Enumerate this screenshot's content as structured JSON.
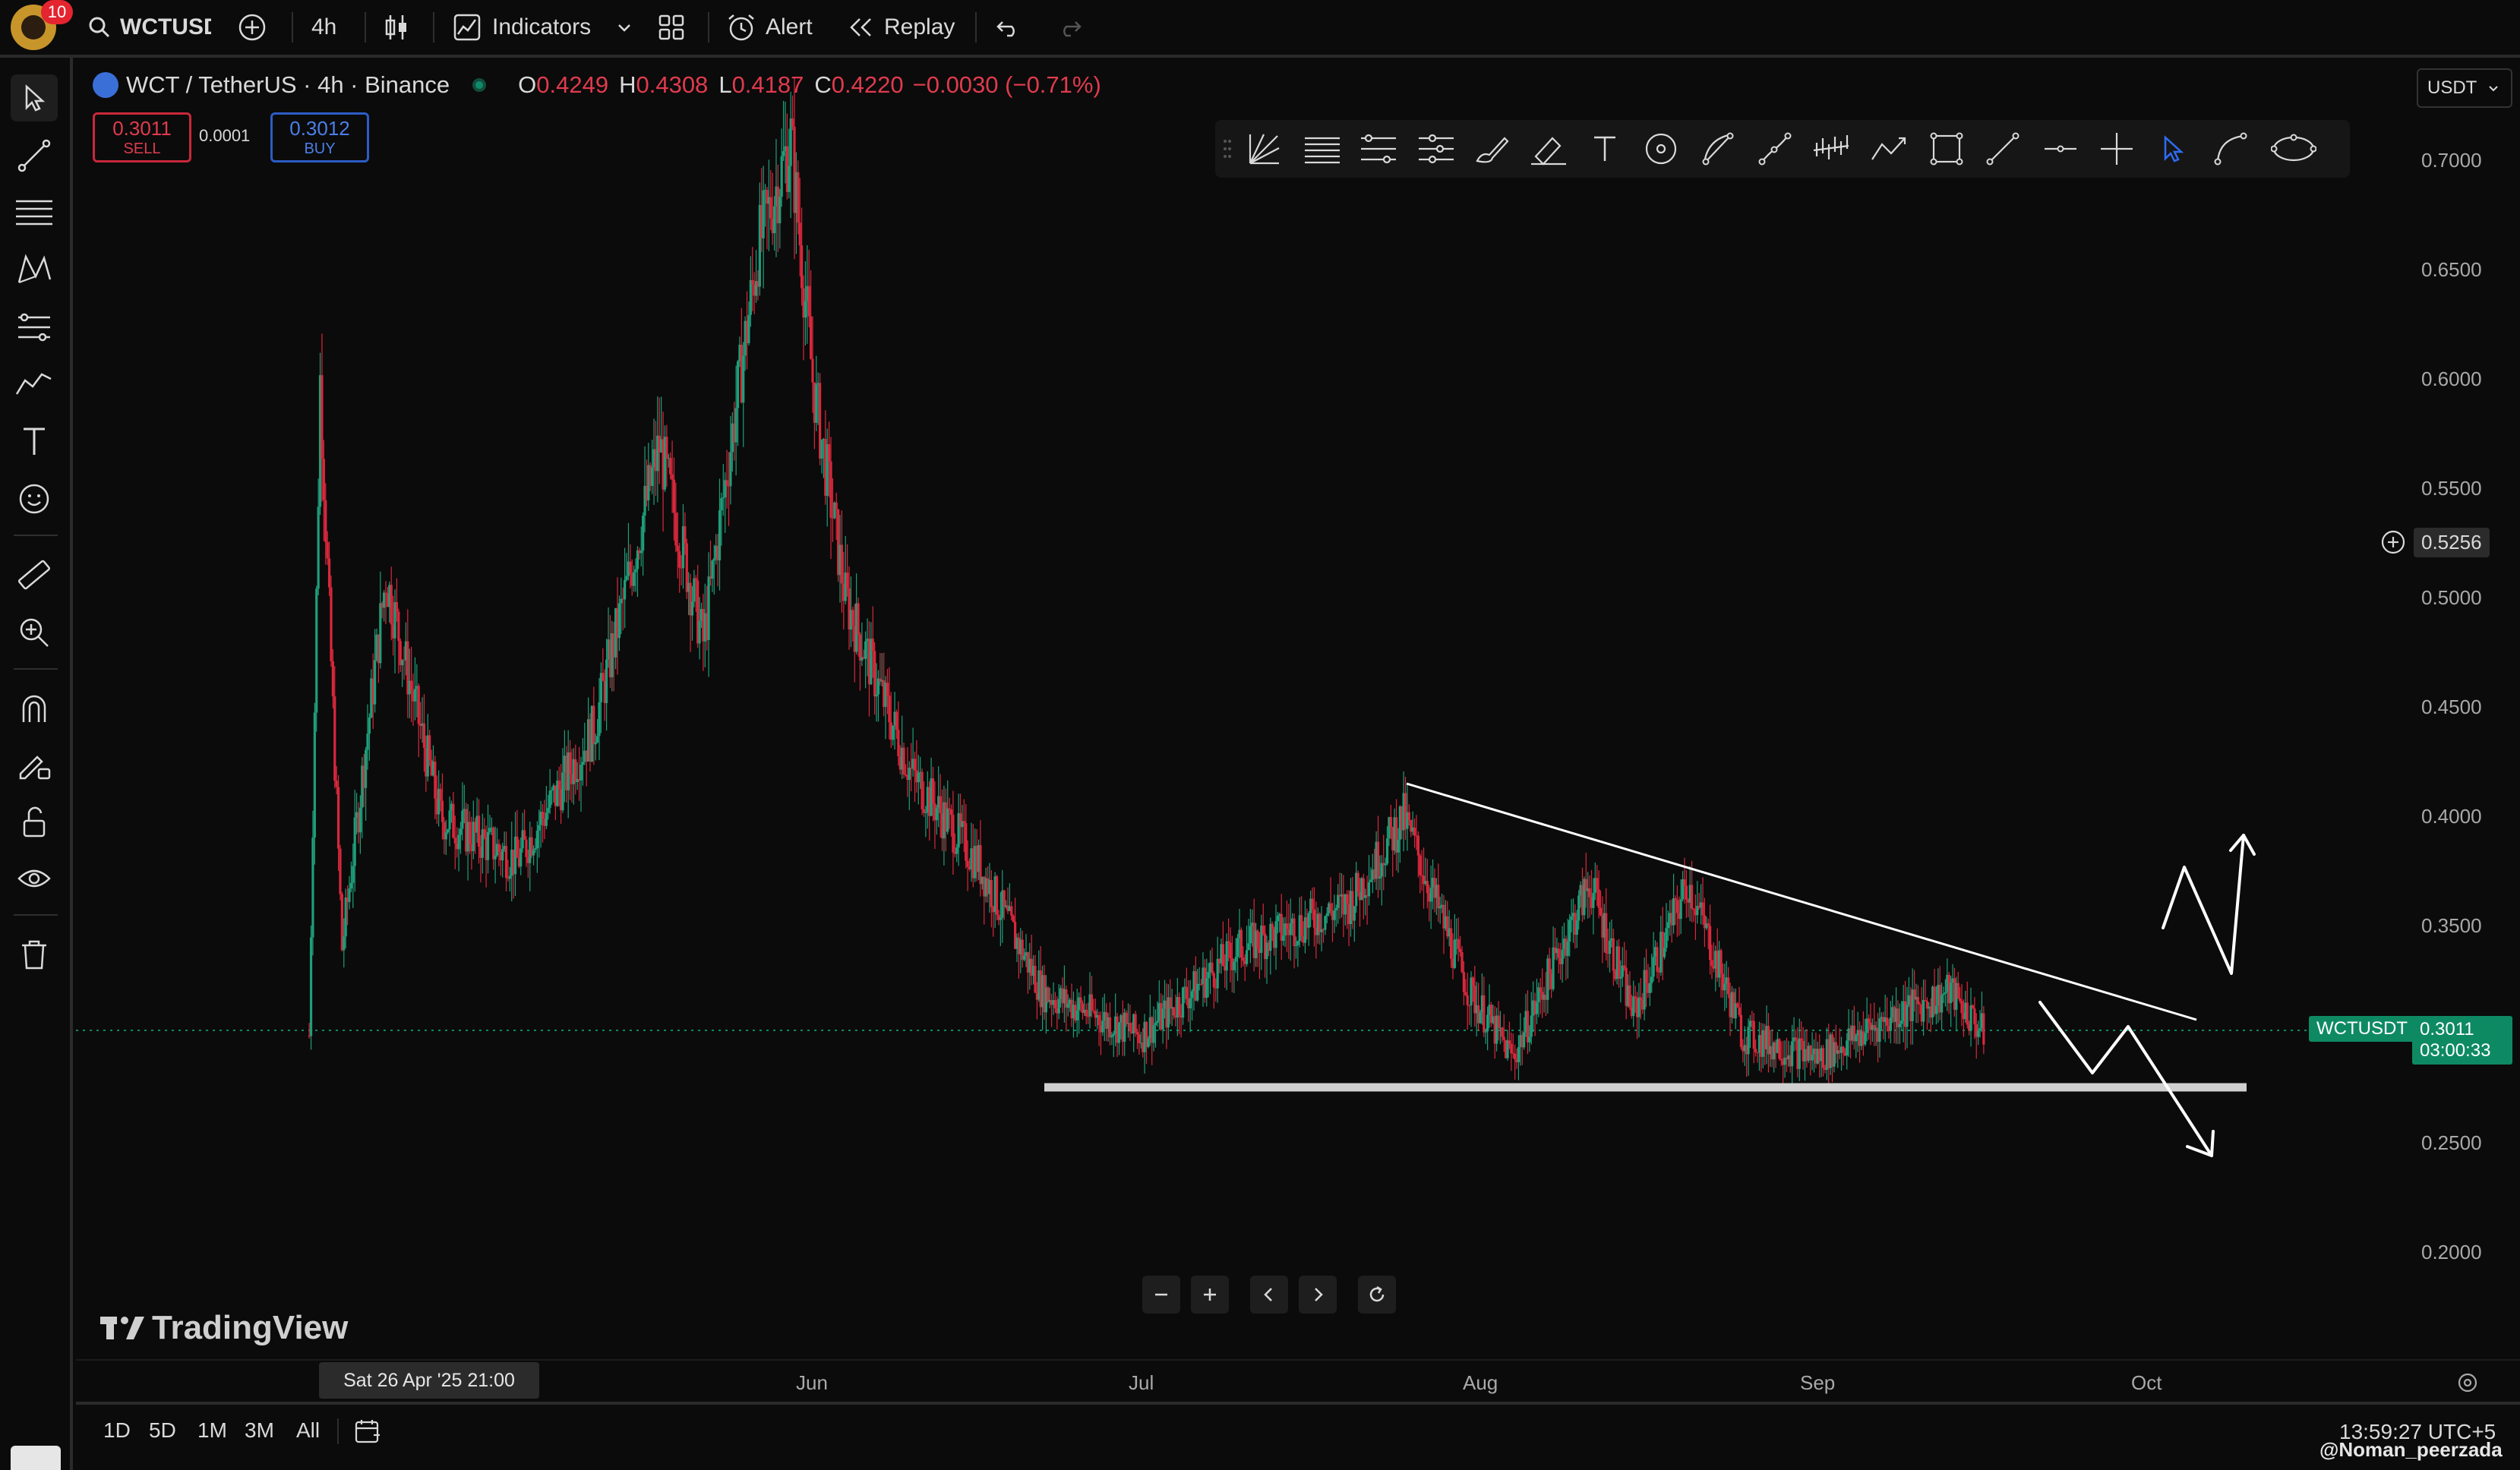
{
  "topbar": {
    "notification_count": "10",
    "symbol": "WCTUSDT",
    "timeframe": "4h",
    "indicators_label": "Indicators",
    "alert_label": "Alert",
    "replay_label": "Replay"
  },
  "legend": {
    "title": "WCT / TetherUS · 4h · Binance",
    "o_label": "O",
    "o": "0.4249",
    "h_label": "H",
    "h": "0.4308",
    "l_label": "L",
    "l": "0.4187",
    "c_label": "C",
    "c": "0.4220",
    "change": "−0.0030 (−0.71%)"
  },
  "trade": {
    "sell_price": "0.3011",
    "sell_label": "SELL",
    "spread": "0.0001",
    "buy_price": "0.3012",
    "buy_label": "BUY"
  },
  "price_axis": {
    "currency": "USDT",
    "ticks": [
      "0.7000",
      "0.6500",
      "0.6000",
      "0.5500",
      "0.5000",
      "0.4500",
      "0.4000",
      "0.3500",
      "0.2500",
      "0.2000"
    ],
    "crosshair_price": "0.5256",
    "symbol_tag": "WCTUSDT",
    "last_price": "0.3011",
    "countdown": "03:00:33"
  },
  "time_axis": {
    "crosshair_date": "Sat 26 Apr '25   21:00",
    "ticks": [
      "Jun",
      "Jul",
      "Aug",
      "Sep",
      "Oct"
    ]
  },
  "watermark": "TradingView",
  "range_buttons": [
    "1D",
    "5D",
    "1M",
    "3M",
    "All"
  ],
  "clock": "13:59:27 UTC+5",
  "credit": "@Noman_peerzada",
  "colors": {
    "up": "#1f9e7a",
    "down": "#d9283c",
    "last_price": "#0e8a63",
    "background": "#0b0b0b"
  },
  "chart_data": {
    "type": "candlestick",
    "symbol": "WCT / TetherUS",
    "interval": "4h",
    "exchange": "Binance",
    "y_ticks": [
      0.7,
      0.65,
      0.6,
      0.55,
      0.5,
      0.45,
      0.4,
      0.35,
      0.25,
      0.2
    ],
    "x_ticks": [
      "Jun",
      "Jul",
      "Aug",
      "Sep",
      "Oct"
    ],
    "last_price": 0.3011,
    "approx_path": [
      {
        "date": "2025-04-16",
        "price": 0.3
      },
      {
        "date": "2025-04-17",
        "price": 0.6
      },
      {
        "date": "2025-04-19",
        "price": 0.34
      },
      {
        "date": "2025-04-23",
        "price": 0.51
      },
      {
        "date": "2025-04-28",
        "price": 0.4
      },
      {
        "date": "2025-05-05",
        "price": 0.38
      },
      {
        "date": "2025-05-12",
        "price": 0.44
      },
      {
        "date": "2025-05-18",
        "price": 0.57
      },
      {
        "date": "2025-05-22",
        "price": 0.48
      },
      {
        "date": "2025-05-27",
        "price": 0.66
      },
      {
        "date": "2025-05-30",
        "price": 0.71
      },
      {
        "date": "2025-06-01",
        "price": 0.6
      },
      {
        "date": "2025-06-04",
        "price": 0.5
      },
      {
        "date": "2025-06-10",
        "price": 0.42
      },
      {
        "date": "2025-06-16",
        "price": 0.38
      },
      {
        "date": "2025-06-22",
        "price": 0.32
      },
      {
        "date": "2025-07-01",
        "price": 0.3
      },
      {
        "date": "2025-07-10",
        "price": 0.34
      },
      {
        "date": "2025-07-20",
        "price": 0.36
      },
      {
        "date": "2025-07-25",
        "price": 0.4
      },
      {
        "date": "2025-07-31",
        "price": 0.32
      },
      {
        "date": "2025-08-04",
        "price": 0.29
      },
      {
        "date": "2025-08-11",
        "price": 0.37
      },
      {
        "date": "2025-08-15",
        "price": 0.31
      },
      {
        "date": "2025-08-20",
        "price": 0.37
      },
      {
        "date": "2025-08-25",
        "price": 0.3
      },
      {
        "date": "2025-09-01",
        "price": 0.29
      },
      {
        "date": "2025-09-08",
        "price": 0.31
      },
      {
        "date": "2025-09-13",
        "price": 0.32
      },
      {
        "date": "2025-09-16",
        "price": 0.301
      }
    ],
    "drawings": {
      "descending_trendline": [
        {
          "date": "2025-07-25",
          "price": 0.414
        },
        {
          "date": "2025-10-02",
          "price": 0.305
        }
      ],
      "support_line": {
        "price": 0.2775,
        "from": "2025-06-24",
        "to": "2025-10-03"
      },
      "projection_up": "zigzag breakout up",
      "projection_down": "zigzag breakdown below support"
    }
  }
}
